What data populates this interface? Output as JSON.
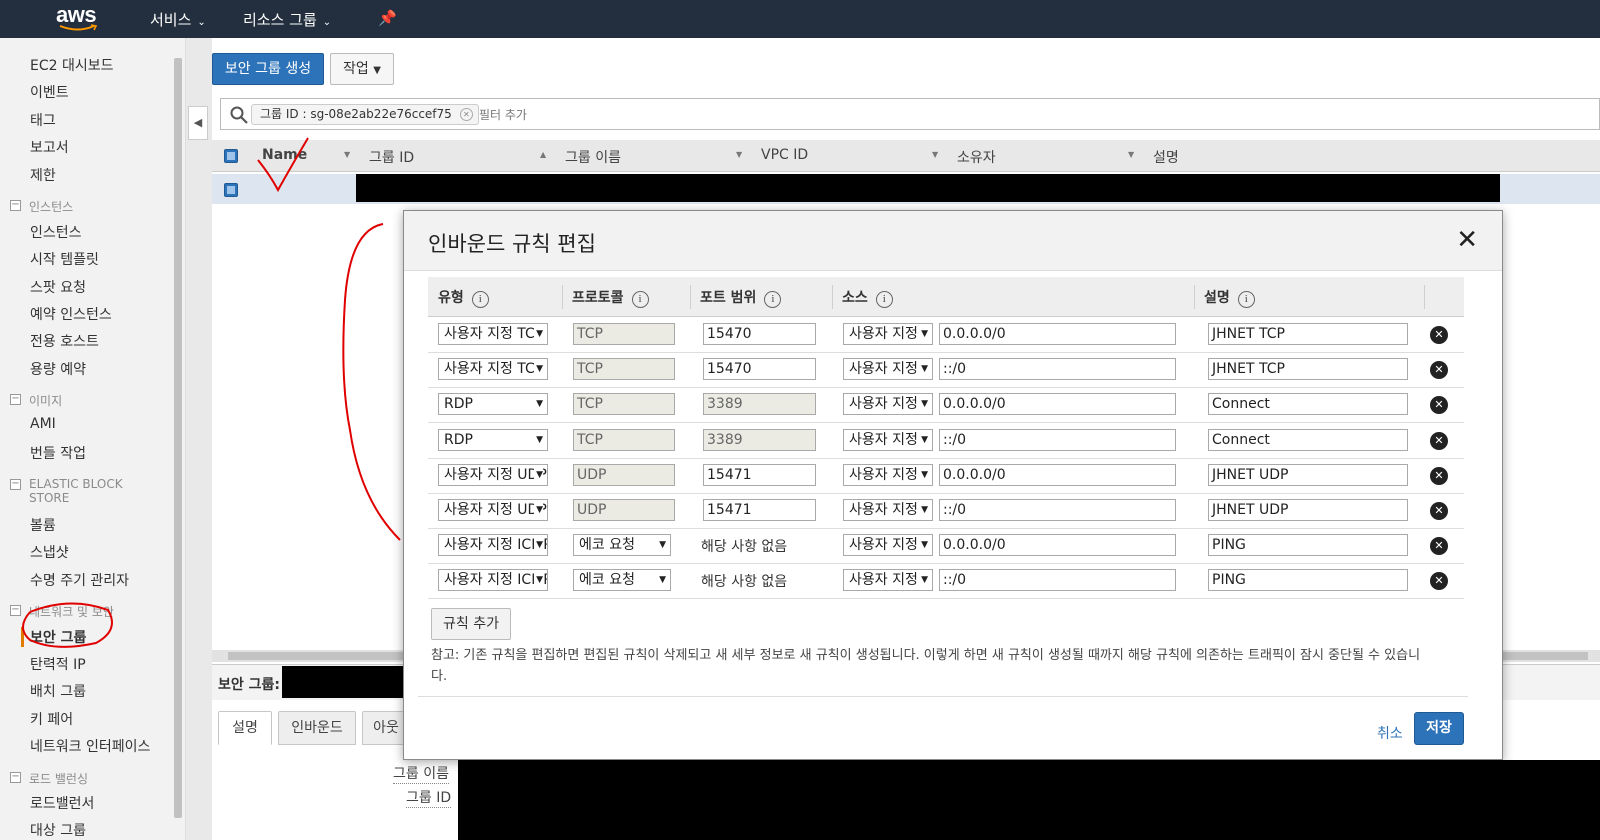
{
  "topbar": {
    "logo": "aws",
    "services": "서비스",
    "resource_groups": "리소스 그룹",
    "pin_icon": "pin-icon"
  },
  "sidebar": {
    "top": [
      "EC2 대시보드",
      "이벤트",
      "태그",
      "보고서",
      "제한"
    ],
    "instances_section": "인스턴스",
    "instances": [
      "인스턴스",
      "시작 템플릿",
      "스팟 요청",
      "예약 인스턴스",
      "전용 호스트",
      "용량 예약"
    ],
    "images_section": "이미지",
    "images": [
      "AMI",
      "번들 작업"
    ],
    "ebs_section": "ELASTIC BLOCK STORE",
    "ebs": [
      "볼륨",
      "스냅샷",
      "수명 주기 관리자"
    ],
    "network_section": "네트워크 및 보안",
    "network": [
      "보안 그룹",
      "탄력적 IP",
      "배치 그룹",
      "키 페어",
      "네트워크 인터페이스"
    ],
    "lb_section": "로드 밸런싱",
    "lb": [
      "로드밸런서",
      "대상 그룹"
    ]
  },
  "toolbar": {
    "create_button": "보안 그룹 생성",
    "actions_button": "작업"
  },
  "search": {
    "chip": "그룹 ID : sg-08e2ab22e76ccef75",
    "add_filter": "필터 추가"
  },
  "table": {
    "columns": [
      "Name",
      "그룹 ID",
      "그룹 이름",
      "VPC ID",
      "소유자",
      "설명"
    ]
  },
  "details": {
    "title": "보안 그룹:",
    "tabs": [
      "설명",
      "인바운드",
      "아웃"
    ],
    "labels": [
      "그룹 이름",
      "그룹 ID"
    ]
  },
  "modal": {
    "title": "인바운드 규칙 편집",
    "columns": [
      "유형",
      "프로토콜",
      "포트 범위",
      "소스",
      "설명"
    ],
    "rules": [
      {
        "type": "사용자 지정 TCP",
        "protocol": "TCP",
        "port": "15470",
        "port_ro": false,
        "protocol_select": false,
        "source_type": "사용자 지정",
        "source": "0.0.0.0/0",
        "desc": "JHNET TCP"
      },
      {
        "type": "사용자 지정 TCP",
        "protocol": "TCP",
        "port": "15470",
        "port_ro": false,
        "protocol_select": false,
        "source_type": "사용자 지정",
        "source": "::/0",
        "desc": "JHNET TCP"
      },
      {
        "type": "RDP",
        "protocol": "TCP",
        "port": "3389",
        "port_ro": true,
        "protocol_select": false,
        "source_type": "사용자 지정",
        "source": "0.0.0.0/0",
        "desc": "Connect"
      },
      {
        "type": "RDP",
        "protocol": "TCP",
        "port": "3389",
        "port_ro": true,
        "protocol_select": false,
        "source_type": "사용자 지정",
        "source": "::/0",
        "desc": "Connect"
      },
      {
        "type": "사용자 지정 UDP",
        "protocol": "UDP",
        "port": "15471",
        "port_ro": false,
        "protocol_select": false,
        "source_type": "사용자 지정",
        "source": "0.0.0.0/0",
        "desc": "JHNET UDP"
      },
      {
        "type": "사용자 지정 UDP",
        "protocol": "UDP",
        "port": "15471",
        "port_ro": false,
        "protocol_select": false,
        "source_type": "사용자 지정",
        "source": "::/0",
        "desc": "JHNET UDP"
      },
      {
        "type": "사용자 지정 ICMP",
        "protocol": "에코 요청",
        "port": "해당 사항 없음",
        "port_ro": false,
        "protocol_select": true,
        "source_type": "사용자 지정",
        "source": "0.0.0.0/0",
        "desc": "PING"
      },
      {
        "type": "사용자 지정 ICMP",
        "protocol": "에코 요청",
        "port": "해당 사항 없음",
        "port_ro": false,
        "protocol_select": true,
        "source_type": "사용자 지정",
        "source": "::/0",
        "desc": "PING"
      }
    ],
    "add_rule": "규칙 추가",
    "note": "참고: 기존 규칙을 편집하면 편집된 규칙이 삭제되고 새 세부 정보로 새 규칙이 생성됩니다. 이렇게 하면 새 규칙이 생성될 때까지 해당 규칙에 의존하는 트래픽이 잠시 중단될 수 있습니다.",
    "cancel": "취소",
    "save": "저장"
  },
  "colors": {
    "topbar": "#232f3e",
    "primary": "#2d73b9",
    "annotation": "#e00000"
  }
}
